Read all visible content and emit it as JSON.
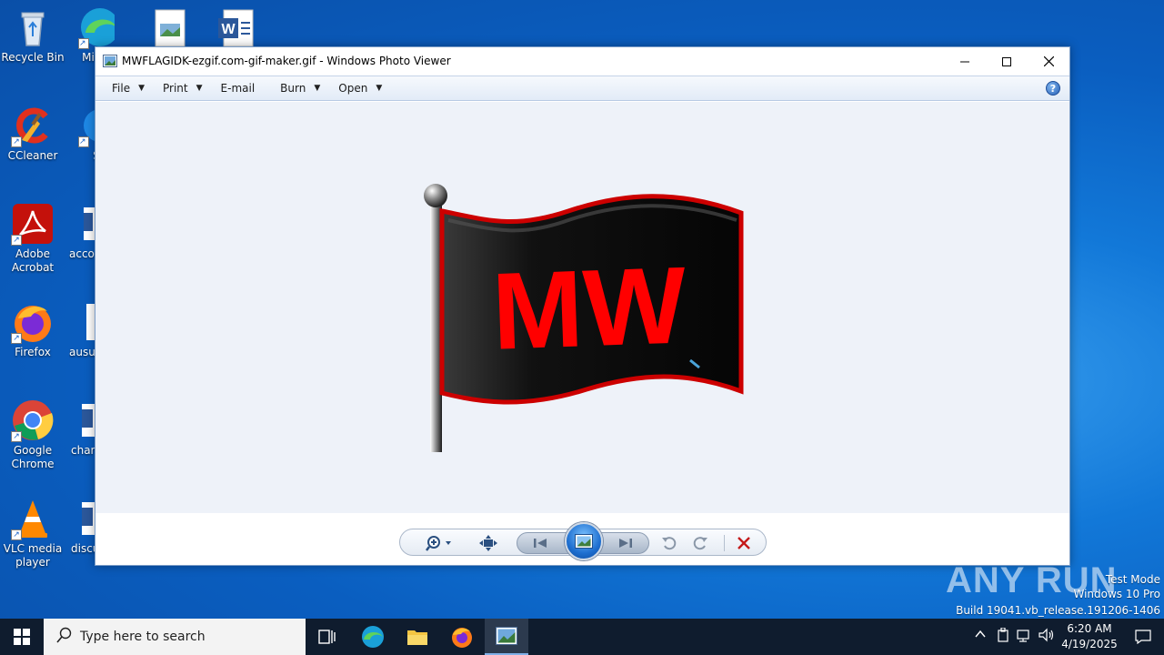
{
  "desktop": {
    "icons": [
      {
        "label": "Recycle Bin"
      },
      {
        "label": "CCleaner"
      },
      {
        "label": "Adobe Acrobat"
      },
      {
        "label": "Firefox"
      },
      {
        "label": "Google Chrome"
      },
      {
        "label": "VLC media player"
      }
    ],
    "partial_icons": [
      {
        "label": "Mic E"
      },
      {
        "label": "S"
      },
      {
        "label": "acco"
      },
      {
        "label": "ausu"
      },
      {
        "label": "char"
      },
      {
        "label": "discu"
      }
    ]
  },
  "window": {
    "title": "MWFLAGIDK-ezgif.com-gif-maker.gif - Windows Photo Viewer",
    "menu": [
      {
        "label": "File",
        "has_arrow": true
      },
      {
        "label": "Print",
        "has_arrow": true
      },
      {
        "label": "E-mail",
        "has_arrow": false
      },
      {
        "label": "Burn",
        "has_arrow": true
      },
      {
        "label": "Open",
        "has_arrow": true
      }
    ],
    "help": "?",
    "image": {
      "flag_text": "MW",
      "flag_color": "#0a0a0a",
      "text_color": "#ff0000",
      "border_color": "#cc0000"
    }
  },
  "taskbar": {
    "search_placeholder": "Type here to search",
    "time": "6:20 AM",
    "date": "4/19/2025"
  },
  "watermark": {
    "brand": "ANY RUN",
    "mode": "Test Mode",
    "edition": "Windows 10 Pro",
    "build": "Build 19041.vb_release.191206-1406"
  },
  "colors": {
    "accent": "#1e6fd0",
    "desktop": "#0a5ec0",
    "taskbar": "#0f1c2e"
  }
}
